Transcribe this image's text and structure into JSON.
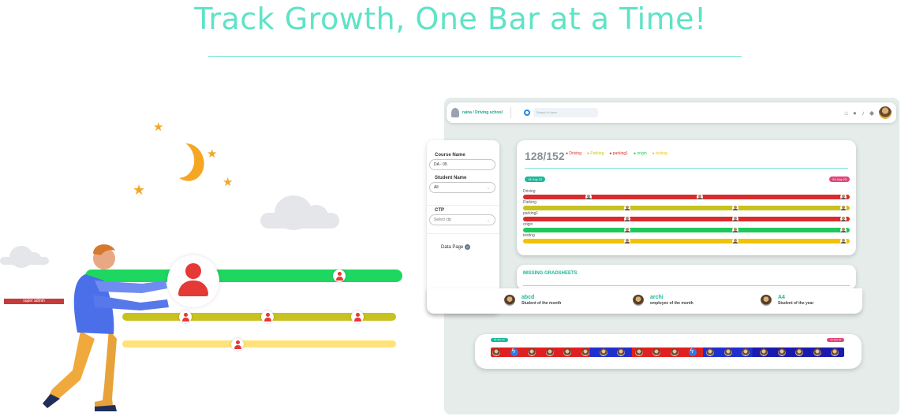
{
  "headline": "Track Growth, One Bar at a Time!",
  "colors": {
    "headline": "#5fe3c6",
    "accent": "#19b99a",
    "driving": "#d92c2c",
    "parking": "#c7c21f",
    "parking1": "#d92c2c",
    "origin": "#1ec85a",
    "testing": "#f2c20a"
  },
  "illustration": {
    "bars": [
      {
        "color": "#1ed760",
        "pins": [
          0.8
        ]
      },
      {
        "color": "#c7c21f",
        "pins": [
          0.23,
          0.53,
          0.86
        ]
      },
      {
        "color": "#ffe27a",
        "pins": [
          0.42
        ]
      }
    ]
  },
  "topbar": {
    "org": "raina / Driving school",
    "search_placeholder": "Search in here",
    "icons": [
      "home-icon",
      "chat-icon",
      "bell-icon",
      "diamond-icon"
    ]
  },
  "sidebar": {
    "course_label": "Course Name",
    "course_value": "DA - 05",
    "student_label": "Student Name",
    "student_value": "All",
    "ctp_label": "CTP",
    "ctp_placeholder": "Select ctp",
    "data_page_label": "Data Page",
    "data_page_badge": "0",
    "role": "super admin"
  },
  "progress": {
    "count": "128/152",
    "legend": [
      "Driving",
      "Parking",
      "parking1",
      "origin",
      "testing"
    ],
    "start_date": "18 July 23",
    "end_date": "24 July 23",
    "tracks": [
      {
        "label": "Driving",
        "color": "#d92c2c",
        "pins": [
          0.2,
          0.54,
          0.98
        ]
      },
      {
        "label": "Parking",
        "color": "#c7c21f",
        "pins": [
          0.32,
          0.65,
          0.98
        ]
      },
      {
        "label": "parking1",
        "color": "#d92c2c",
        "pins": [
          0.32,
          0.65,
          0.98
        ]
      },
      {
        "label": "origin",
        "color": "#1ec85a",
        "pins": [
          0.32,
          0.65,
          0.98
        ]
      },
      {
        "label": "testing",
        "color": "#f2c20a",
        "pins": [
          0.32,
          0.65,
          0.98
        ]
      }
    ]
  },
  "missing": {
    "title": "MISSING GRADSHEETS"
  },
  "awards": [
    {
      "name": "abcd",
      "title": "Student of the month"
    },
    {
      "name": "archi",
      "title": "employee of the month"
    },
    {
      "name": "A4",
      "title": "Student of the year"
    }
  ],
  "strip": {
    "start_date": "18 July 23",
    "end_date": "24 July 23"
  }
}
